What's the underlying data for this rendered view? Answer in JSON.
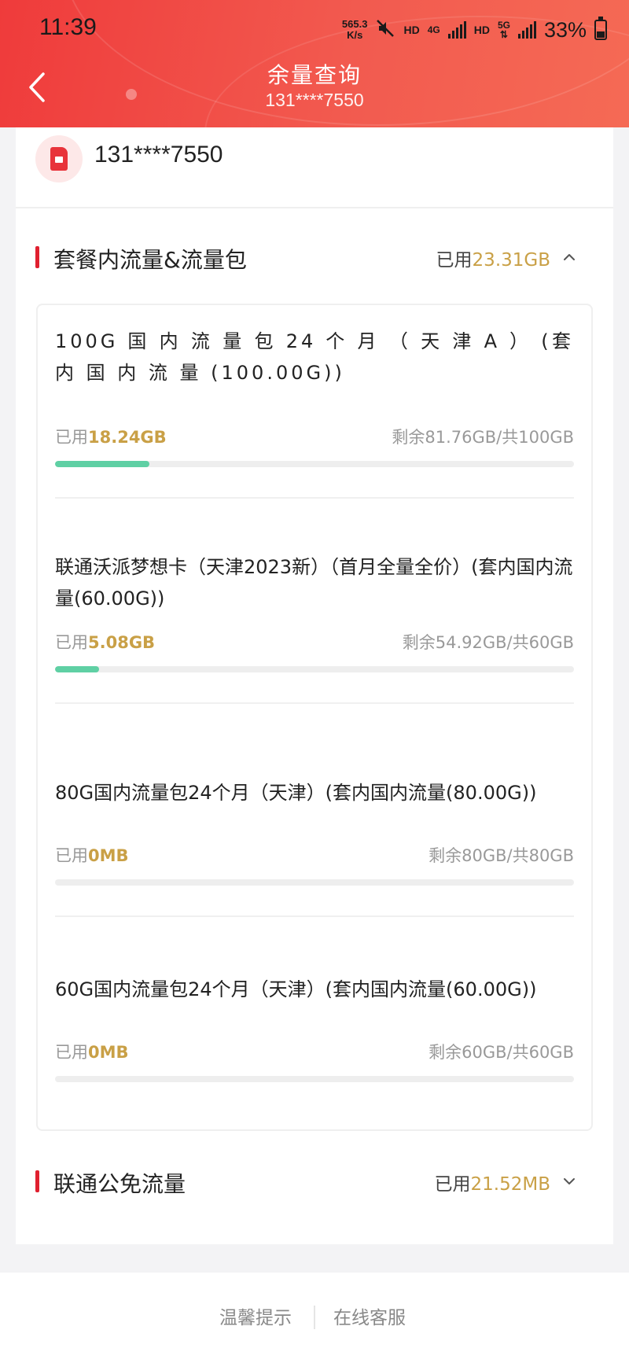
{
  "status_bar": {
    "time": "11:39",
    "net_speed_value": "565.3",
    "net_speed_unit": "K/s",
    "hd1": "HD",
    "gen1": "4G",
    "hd2": "HD",
    "gen2": "5G",
    "battery": "33%"
  },
  "nav": {
    "title": "余量查询",
    "subtitle": "131****7550"
  },
  "account": {
    "number": "131****7550"
  },
  "section_main": {
    "title": "套餐内流量&流量包",
    "used_label": "已用",
    "used_value": "23.31GB",
    "expanded": true
  },
  "packages": [
    {
      "name": "100G 国 内 流 量 包 24 个 月 （ 天 津 A ） (套 内 国 内 流 量 (100.00G))",
      "used_label": "已用",
      "used_value": "18.24GB",
      "remain": "剩余81.76GB/共100GB",
      "used_fraction": 0.1824
    },
    {
      "name": "联通沃派梦想卡（天津2023新）（首月全量全价）(套内国内流量(60.00G))",
      "used_label": "已用",
      "used_value": "5.08GB",
      "remain": "剩余54.92GB/共60GB",
      "used_fraction": 0.0847
    },
    {
      "name": "80G国内流量包24个月（天津）(套内国内流量(80.00G))",
      "used_label": "已用",
      "used_value": "0MB",
      "remain": "剩余80GB/共80GB",
      "used_fraction": 0
    },
    {
      "name": "60G国内流量包24个月（天津）(套内国内流量(60.00G))",
      "used_label": "已用",
      "used_value": "0MB",
      "remain": "剩余60GB/共60GB",
      "used_fraction": 0
    }
  ],
  "section_free": {
    "title": "联通公免流量",
    "used_label": "已用",
    "used_value": "21.52MB",
    "expanded": false
  },
  "footer": {
    "tips": "温馨提示",
    "service": "在线客服"
  },
  "colors": {
    "header_red": "#ef3b3b",
    "accent_gold": "#c9a046",
    "progress_green": "#5fd0a4",
    "section_bar_red": "#e0202f"
  }
}
